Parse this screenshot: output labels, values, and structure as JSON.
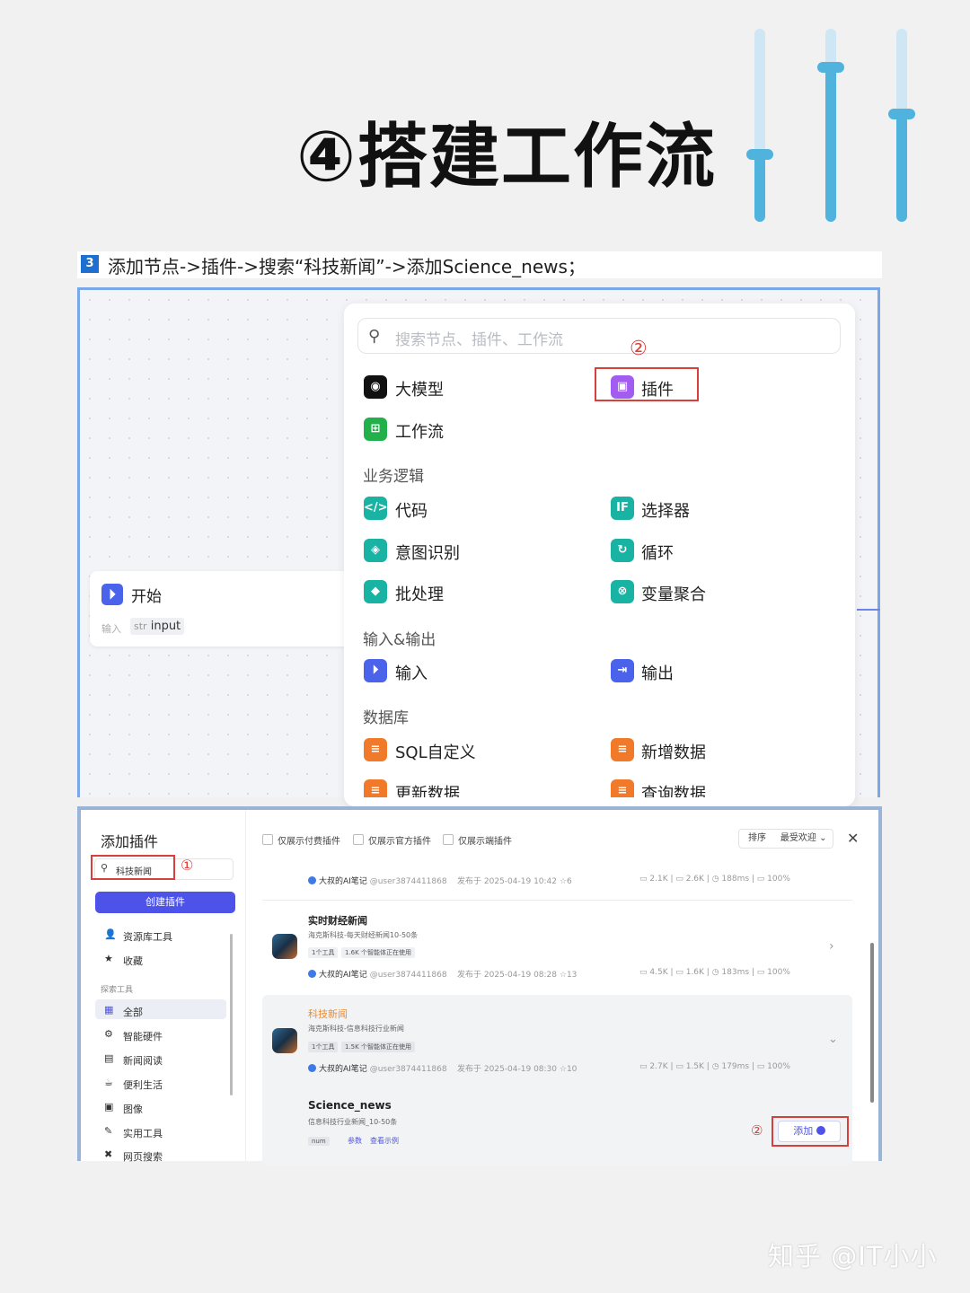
{
  "title": "④搭建工作流",
  "step": {
    "number": "3",
    "text": "添加节点->插件->搜索“科技新闻”->添加Science_news；"
  },
  "canvas": {
    "start_node": {
      "label": "开始",
      "input_label": "输入",
      "input_type": "str",
      "input_name": "input"
    },
    "panel": {
      "search_placeholder": "搜索节点、插件、工作流",
      "marker": "②",
      "top_items": [
        {
          "label": "大模型",
          "icon": "llm-icon",
          "color": "#111111"
        },
        {
          "label": "插件",
          "icon": "plugin-icon",
          "color": "#a25cf0"
        },
        {
          "label": "工作流",
          "icon": "workflow-icon",
          "color": "#22b04b"
        }
      ],
      "sections": [
        {
          "label": "业务逻辑",
          "items": [
            {
              "label": "代码",
              "icon": "code-icon",
              "color": "#19b3a4"
            },
            {
              "label": "选择器",
              "icon": "if-icon",
              "color": "#19b3a4"
            },
            {
              "label": "意图识别",
              "icon": "intent-icon",
              "color": "#19b3a4"
            },
            {
              "label": "循环",
              "icon": "loop-icon",
              "color": "#19b3a4"
            },
            {
              "label": "批处理",
              "icon": "batch-icon",
              "color": "#19b3a4"
            },
            {
              "label": "变量聚合",
              "icon": "aggregate-icon",
              "color": "#19b3a4"
            }
          ]
        },
        {
          "label": "输入&输出",
          "items": [
            {
              "label": "输入",
              "icon": "input-icon",
              "color": "#4a63ea"
            },
            {
              "label": "输出",
              "icon": "output-icon",
              "color": "#4a63ea"
            }
          ]
        },
        {
          "label": "数据库",
          "items": [
            {
              "label": "SQL自定义",
              "icon": "sql-icon",
              "color": "#f07a2a"
            },
            {
              "label": "新增数据",
              "icon": "db-add-icon",
              "color": "#f07a2a"
            },
            {
              "label": "更新数据",
              "icon": "db-update-icon",
              "color": "#f07a2a"
            },
            {
              "label": "查询数据",
              "icon": "db-query-icon",
              "color": "#f07a2a"
            }
          ]
        }
      ]
    }
  },
  "plugin_dialog": {
    "title": "添加插件",
    "search_value": "科技新闻",
    "marker1": "①",
    "create_button": "创建插件",
    "nav_top": [
      {
        "label": "资源库工具",
        "icon": "user-icon"
      },
      {
        "label": "收藏",
        "icon": "star-icon"
      }
    ],
    "category_header": "探索工具",
    "categories": [
      {
        "label": "全部",
        "icon": "grid-icon",
        "selected": true
      },
      {
        "label": "智能硬件",
        "icon": "hardware-icon"
      },
      {
        "label": "新闻阅读",
        "icon": "news-icon"
      },
      {
        "label": "便利生活",
        "icon": "life-icon"
      },
      {
        "label": "图像",
        "icon": "image-icon"
      },
      {
        "label": "实用工具",
        "icon": "tool-icon"
      },
      {
        "label": "网页搜索",
        "icon": "web-search-icon"
      }
    ],
    "filters": [
      "仅展示付费插件",
      "仅展示官方插件",
      "仅展示端插件"
    ],
    "sort_label": "排序",
    "sort_value": "最受欢迎",
    "rows": [
      {
        "author": "大叔的AI笔记",
        "user": "@user3874411868",
        "published": "发布于 2025-04-19 10:42",
        "stars": "6",
        "stats": [
          "2.1K",
          "2.6K",
          "188ms",
          "100%"
        ]
      },
      {
        "title": "实时财经新闻",
        "desc": "海克斯科技-每天财经新闻10-50条",
        "tags": [
          "1个工具",
          "1.6K 个智能体正在使用"
        ],
        "author": "大叔的AI笔记",
        "user": "@user3874411868",
        "published": "发布于 2025-04-19 08:28",
        "stars": "13",
        "stats": [
          "4.5K",
          "1.6K",
          "183ms",
          "100%"
        ]
      },
      {
        "title": "科技新闻",
        "desc": "海克斯科技-信息科技行业新闻",
        "tags": [
          "1个工具",
          "1.5K 个智能体正在使用"
        ],
        "author": "大叔的AI笔记",
        "user": "@user3874411868",
        "published": "发布于 2025-04-19 08:30",
        "stars": "10",
        "stats": [
          "2.7K",
          "1.5K",
          "179ms",
          "100%"
        ]
      }
    ],
    "tool": {
      "name": "Science_news",
      "desc": "信息科技行业新闻_10-50条",
      "param": "num",
      "links": [
        "参数",
        "查看示例"
      ],
      "marker2": "②",
      "add_button": "添加"
    }
  },
  "watermark": "知乎 @IT小小"
}
